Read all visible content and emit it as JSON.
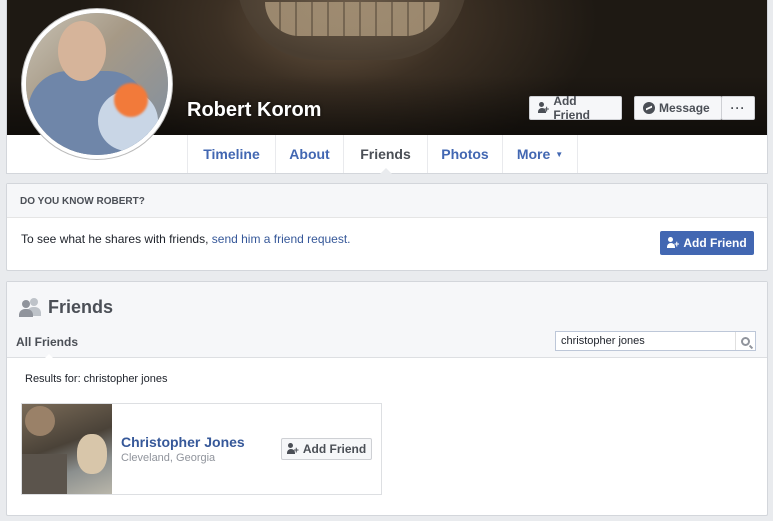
{
  "profile": {
    "name": "Robert Korom",
    "add_friend_label": "Add Friend",
    "message_label": "Message",
    "more_label": "···"
  },
  "tabs": [
    {
      "label": "Timeline"
    },
    {
      "label": "About"
    },
    {
      "label": "Friends"
    },
    {
      "label": "Photos"
    },
    {
      "label": "More"
    }
  ],
  "know_box": {
    "heading": "DO YOU KNOW ROBERT?",
    "text": "To see what he shares with friends, ",
    "link": "send him a friend request.",
    "button_label": "Add Friend"
  },
  "friends": {
    "title": "Friends",
    "subtab": "All Friends",
    "search_value": "christopher jones",
    "results_text": "Results for: christopher jones",
    "items": [
      {
        "name": "Christopher Jones",
        "location": "Cleveland, Georgia",
        "button_label": "Add Friend"
      }
    ]
  },
  "colors": {
    "link": "#365899",
    "primary_button": "#4267b2",
    "page_bg": "#e9ebee"
  }
}
